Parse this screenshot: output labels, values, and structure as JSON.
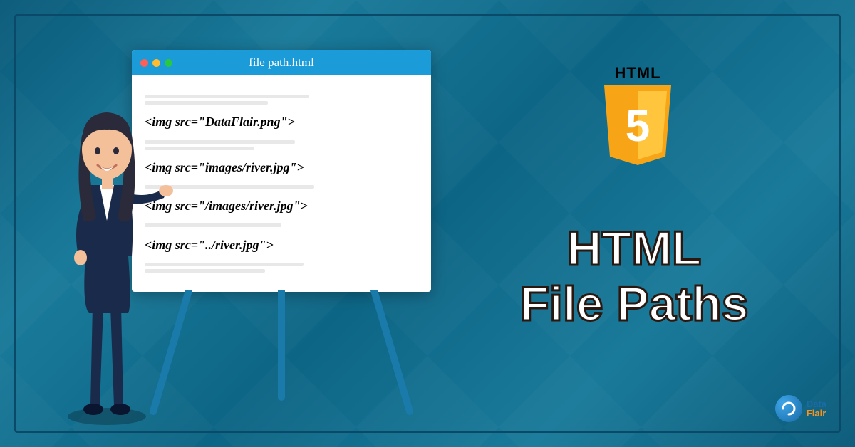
{
  "window": {
    "title": "file path.html",
    "code_lines": [
      "<img src=\"DataFlair.png\">",
      "<img src=\"images/river.jpg\">",
      "<img src=\"/images/river.jpg\">",
      "<img src=\"../river.jpg\">"
    ]
  },
  "html5": {
    "label": "HTML",
    "version": "5"
  },
  "title": {
    "line1": "HTML",
    "line2": "File Paths"
  },
  "brand": {
    "name1": "Data",
    "name2": "Flair"
  }
}
